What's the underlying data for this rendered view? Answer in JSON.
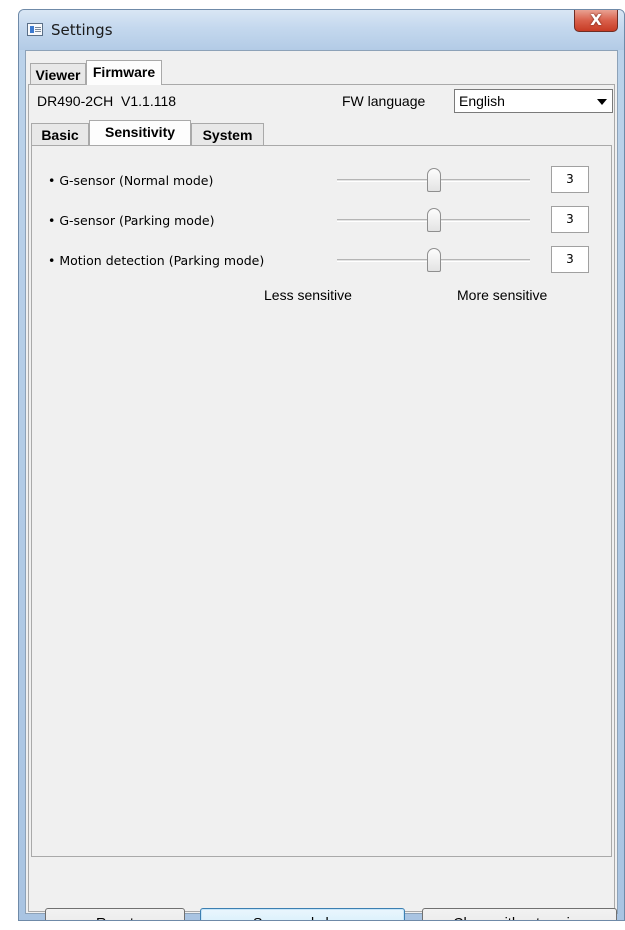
{
  "window": {
    "title": "Settings",
    "close_glyph": "X",
    "title_icon": "settings-window-icon"
  },
  "top_tabs": [
    {
      "label": "Viewer",
      "active": false
    },
    {
      "label": "Firmware",
      "active": true
    }
  ],
  "firmware": {
    "model": "DR490-2CH",
    "version": "V1.1.118",
    "fw_language_label": "FW language",
    "fw_language_value": "English",
    "dropdown_icon": "chevron-down-icon"
  },
  "sub_tabs": [
    {
      "label": "Basic",
      "active": false
    },
    {
      "label": "Sensitivity",
      "active": true
    },
    {
      "label": "System",
      "active": false
    }
  ],
  "sensitivity": {
    "rows": [
      {
        "label": "• G-sensor (Normal mode)",
        "value": "3",
        "min": 1,
        "max": 5,
        "level": 3
      },
      {
        "label": "• G-sensor (Parking mode)",
        "value": "3",
        "min": 1,
        "max": 5,
        "level": 3
      },
      {
        "label": "• Motion detection (Parking mode)",
        "value": "3",
        "min": 1,
        "max": 5,
        "level": 3
      }
    ],
    "scale_less": "Less sensitive",
    "scale_more": "More sensitive"
  },
  "buttons": {
    "reset": "Reset",
    "save": "Save and close",
    "close": "Close without saving"
  },
  "colors": {
    "titlebar": "#c4d8ee",
    "close_button": "#d9604b",
    "default_button": "#bee6fd"
  }
}
